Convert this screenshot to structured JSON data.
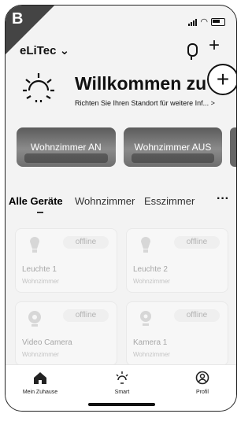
{
  "badge": "B",
  "status_bar": {
    "wifi_icon": "wifi-icon",
    "battery_icon": "battery-icon"
  },
  "header": {
    "home_name": "eLiTec ⌄",
    "mic_icon": "microphone-icon",
    "add_icon": "+"
  },
  "add_button": {
    "label": "+"
  },
  "welcome": {
    "title": "Willkommen zu H",
    "subtitle": "Richten Sie Ihren Standort für weitere Inf... >"
  },
  "scenes": [
    {
      "label": "Wohnzimmer AN"
    },
    {
      "label": "Wohnzimmer AUS"
    }
  ],
  "tabs": {
    "items": [
      "Alle Geräte",
      "Wohnzimmer",
      "Esszimmer"
    ],
    "more": "···",
    "active": "Alle Geräte"
  },
  "devices": [
    {
      "name": "Leuchte 1",
      "room": "Wohnzimmer",
      "status": "offline",
      "icon": "bulb-icon"
    },
    {
      "name": "Leuchte 2",
      "room": "Wohnzimmer",
      "status": "offline",
      "icon": "bulb-icon"
    },
    {
      "name": "Video Camera",
      "room": "Wohnzimmer",
      "status": "offline",
      "icon": "camera-icon"
    },
    {
      "name": "Kamera 1",
      "room": "Wohnzimmer",
      "status": "offline",
      "icon": "camera-icon"
    }
  ],
  "bottom_nav": [
    {
      "label": "Mein Zuhause",
      "icon": "home-icon"
    },
    {
      "label": "Smart",
      "icon": "sun-icon"
    },
    {
      "label": "Profil",
      "icon": "profile-icon"
    }
  ],
  "colors": {
    "badge": "#444444",
    "text": "#111111",
    "muted": "#a7a7a7"
  }
}
